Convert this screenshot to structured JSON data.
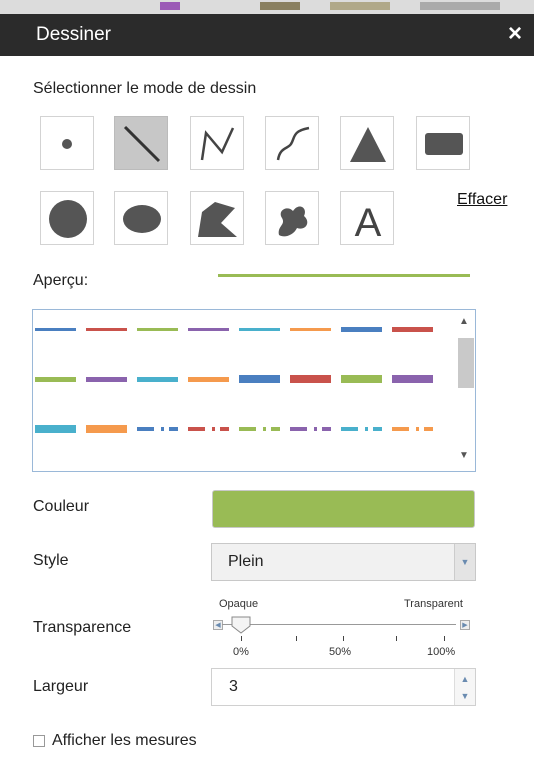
{
  "window": {
    "title": "Dessiner",
    "close_glyph": "×"
  },
  "mode_section": {
    "heading": "Sélectionner le mode de dessin",
    "modes": [
      {
        "name": "point",
        "icon": "point-icon",
        "selected": false
      },
      {
        "name": "line",
        "icon": "line-icon",
        "selected": true
      },
      {
        "name": "polyline",
        "icon": "polyline-icon",
        "selected": false
      },
      {
        "name": "freehand-polyline",
        "icon": "freehand-polyline-icon",
        "selected": false
      },
      {
        "name": "triangle",
        "icon": "triangle-icon",
        "selected": false
      },
      {
        "name": "rectangle",
        "icon": "rectangle-icon",
        "selected": false
      },
      {
        "name": "circle",
        "icon": "circle-icon",
        "selected": false
      },
      {
        "name": "ellipse",
        "icon": "ellipse-icon",
        "selected": false
      },
      {
        "name": "polygon",
        "icon": "polygon-icon",
        "selected": false
      },
      {
        "name": "freehand-polygon",
        "icon": "freehand-polygon-icon",
        "selected": false
      },
      {
        "name": "text",
        "icon": "text-icon",
        "selected": false
      }
    ],
    "clear_label": "Effacer",
    "text_mode_glyph": "A"
  },
  "preview": {
    "label": "Aperçu:",
    "line_color": "#99bb55"
  },
  "line_styles": {
    "colors": [
      "#4a7fc0",
      "#c9524b",
      "#99bb55",
      "#8a63ad",
      "#49b0cc",
      "#f59a4d"
    ],
    "rows": [
      [
        {
          "color": "#4a7fc0",
          "style": "thin-solid"
        },
        {
          "color": "#c9524b",
          "style": "thin-solid"
        },
        {
          "color": "#99bb55",
          "style": "thin-solid"
        },
        {
          "color": "#8a63ad",
          "style": "thin-solid"
        },
        {
          "color": "#49b0cc",
          "style": "thin-solid"
        },
        {
          "color": "#f59a4d",
          "style": "thin-solid"
        },
        {
          "color": "#4a7fc0",
          "style": "medium-solid"
        },
        {
          "color": "#c9524b",
          "style": "medium-solid"
        }
      ],
      [
        {
          "color": "#99bb55",
          "style": "medium-solid"
        },
        {
          "color": "#8a63ad",
          "style": "medium-solid"
        },
        {
          "color": "#49b0cc",
          "style": "medium-solid"
        },
        {
          "color": "#f59a4d",
          "style": "medium-solid"
        },
        {
          "color": "#4a7fc0",
          "style": "thick-solid"
        },
        {
          "color": "#c9524b",
          "style": "thick-solid"
        },
        {
          "color": "#99bb55",
          "style": "thick-solid"
        },
        {
          "color": "#8a63ad",
          "style": "thick-solid"
        }
      ],
      [
        {
          "color": "#49b0cc",
          "style": "thick-solid"
        },
        {
          "color": "#f59a4d",
          "style": "thick-solid"
        },
        {
          "color": "#4a7fc0",
          "style": "dash-dot"
        },
        {
          "color": "#c9524b",
          "style": "dash-dot"
        },
        {
          "color": "#99bb55",
          "style": "dash-dot"
        },
        {
          "color": "#8a63ad",
          "style": "dash-dot"
        },
        {
          "color": "#49b0cc",
          "style": "dash-dot"
        },
        {
          "color": "#f59a4d",
          "style": "dash-dot"
        }
      ]
    ]
  },
  "form": {
    "color_label": "Couleur",
    "color_value": "#99bb55",
    "style_label": "Style",
    "style_value": "Plein",
    "transparency_label": "Transparence",
    "opaque_label": "Opaque",
    "transparent_label": "Transparent",
    "tick_labels": [
      "0%",
      "50%",
      "100%"
    ],
    "transparency_value": 0,
    "width_label": "Largeur",
    "width_value": "3",
    "show_measurements_label": "Afficher les mesures",
    "show_measurements_checked": false
  }
}
